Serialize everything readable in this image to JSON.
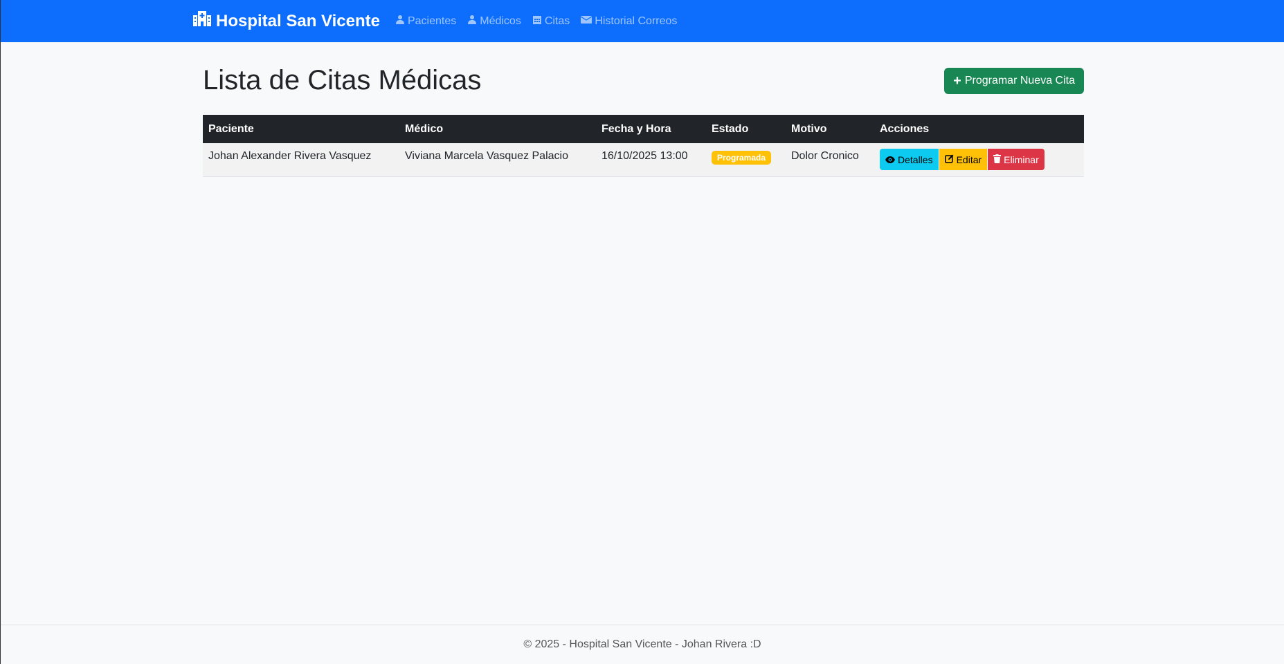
{
  "navbar": {
    "brand": "Hospital San Vicente",
    "brand_icon": "hospital-icon",
    "links": [
      {
        "label": "Pacientes",
        "icon": "user-injured-icon"
      },
      {
        "label": "Médicos",
        "icon": "user-doctor-icon"
      },
      {
        "label": "Citas",
        "icon": "calendar-icon"
      },
      {
        "label": "Historial Correos",
        "icon": "envelope-icon"
      }
    ]
  },
  "main": {
    "title": "Lista de Citas Médicas",
    "new_button": "Programar Nueva Cita",
    "table": {
      "headers": [
        "Paciente",
        "Médico",
        "Fecha y Hora",
        "Estado",
        "Motivo",
        "Acciones"
      ],
      "rows": [
        {
          "paciente": "Johan Alexander Rivera Vasquez",
          "medico": "Viviana Marcela Vasquez Palacio",
          "fecha": "16/10/2025 13:00",
          "estado": "Programada",
          "motivo": "Dolor Cronico",
          "actions": {
            "details": "Detalles",
            "edit": "Editar",
            "delete": "Eliminar"
          }
        }
      ]
    }
  },
  "footer": {
    "text": "© 2025 - Hospital San Vicente - Johan Rivera :D"
  },
  "colors": {
    "navbar": "#0d6efd",
    "success": "#198754",
    "info": "#0dcaf0",
    "warning": "#ffc107",
    "danger": "#dc3545",
    "table_header": "#212529"
  }
}
